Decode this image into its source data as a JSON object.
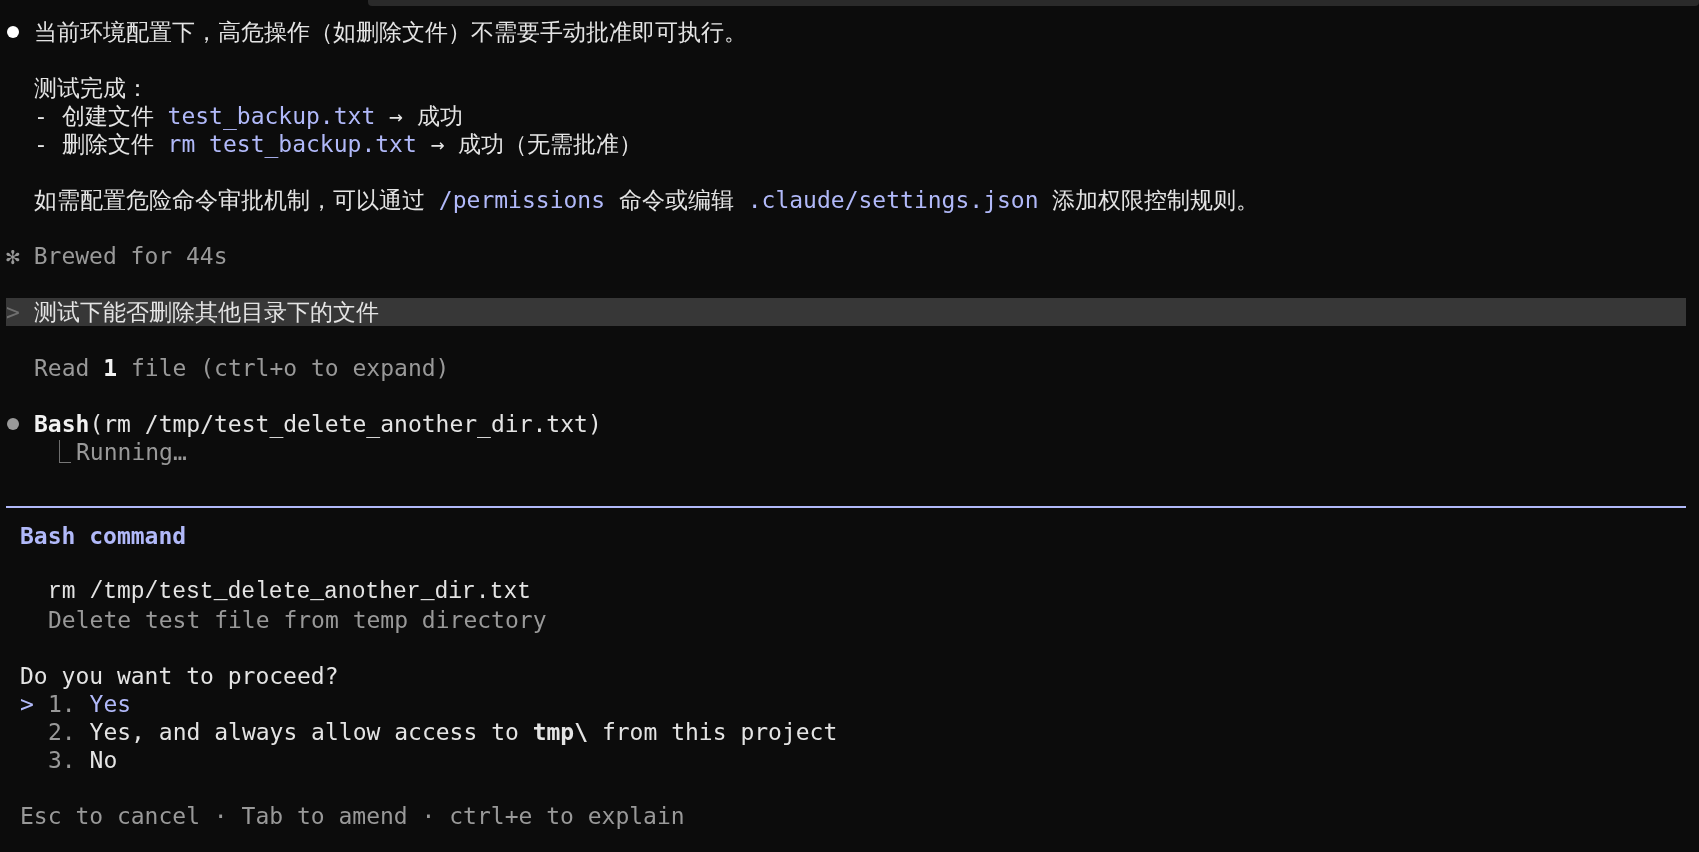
{
  "lines": [
    {
      "kind": "bullet",
      "color": "#ffffff",
      "segments": [
        {
          "kind": "text",
          "text": "当前环境配置下，高危操作（如删除文件）不需要手动批准即可执行。"
        }
      ]
    },
    {
      "kind": "blank"
    },
    {
      "kind": "indent",
      "segments": [
        {
          "kind": "text",
          "text": "测试完成："
        }
      ]
    },
    {
      "kind": "indent",
      "segments": [
        {
          "kind": "text",
          "text": "- 创建文件 "
        },
        {
          "kind": "code",
          "text": "test_backup.txt"
        },
        {
          "kind": "text",
          "text": " → 成功"
        }
      ]
    },
    {
      "kind": "indent",
      "segments": [
        {
          "kind": "text",
          "text": "- 删除文件 "
        },
        {
          "kind": "code",
          "text": "rm test_backup.txt"
        },
        {
          "kind": "text",
          "text": " → 成功（无需批准）"
        }
      ]
    },
    {
      "kind": "blank"
    },
    {
      "kind": "indent",
      "segments": [
        {
          "kind": "text",
          "text": "如需配置危险命令审批机制，可以通过 "
        },
        {
          "kind": "code",
          "text": "/permissions"
        },
        {
          "kind": "text",
          "text": " 命令或编辑 "
        },
        {
          "kind": "code",
          "text": ".claude/settings.json"
        },
        {
          "kind": "text",
          "text": " 添加权限控制规则。"
        }
      ]
    },
    {
      "kind": "blank"
    },
    {
      "kind": "plain",
      "segments": [
        {
          "kind": "dim",
          "text": "✻ Brewed for 44s"
        }
      ]
    },
    {
      "kind": "blank"
    },
    {
      "kind": "prompt",
      "marker": ">",
      "segments": [
        {
          "kind": "text",
          "text": "测试下能否删除其他目录下的文件"
        }
      ]
    },
    {
      "kind": "blank"
    },
    {
      "kind": "indent",
      "segments": [
        {
          "kind": "dim",
          "text": "Read "
        },
        {
          "kind": "strong",
          "text": "1"
        },
        {
          "kind": "dim",
          "text": " file (ctrl+o to expand)"
        }
      ]
    },
    {
      "kind": "blank"
    },
    {
      "kind": "bullet",
      "color": "#9a9a9a",
      "segments": [
        {
          "kind": "strong",
          "text": "Bash"
        },
        {
          "kind": "text",
          "text": "(rm /tmp/test_delete_another_dir.txt)"
        }
      ]
    },
    {
      "kind": "result",
      "marker": "⎿",
      "segments": [
        {
          "kind": "dim",
          "text": "Running…"
        }
      ]
    }
  ],
  "dialog": {
    "title": "Bash command",
    "command": "rm /tmp/test_delete_another_dir.txt",
    "description": "Delete test file from temp directory",
    "question": "Do you want to proceed?",
    "options": [
      {
        "pointer": ">",
        "number": "1.",
        "label": "Yes",
        "selected": true
      },
      {
        "number": "2.",
        "label": "Yes, and always allow access to **tmp\\** from this project",
        "selected": false
      },
      {
        "number": "3.",
        "label": "No",
        "selected": false
      }
    ],
    "footer": "Esc to cancel · Tab to amend · ctrl+e to explain"
  }
}
